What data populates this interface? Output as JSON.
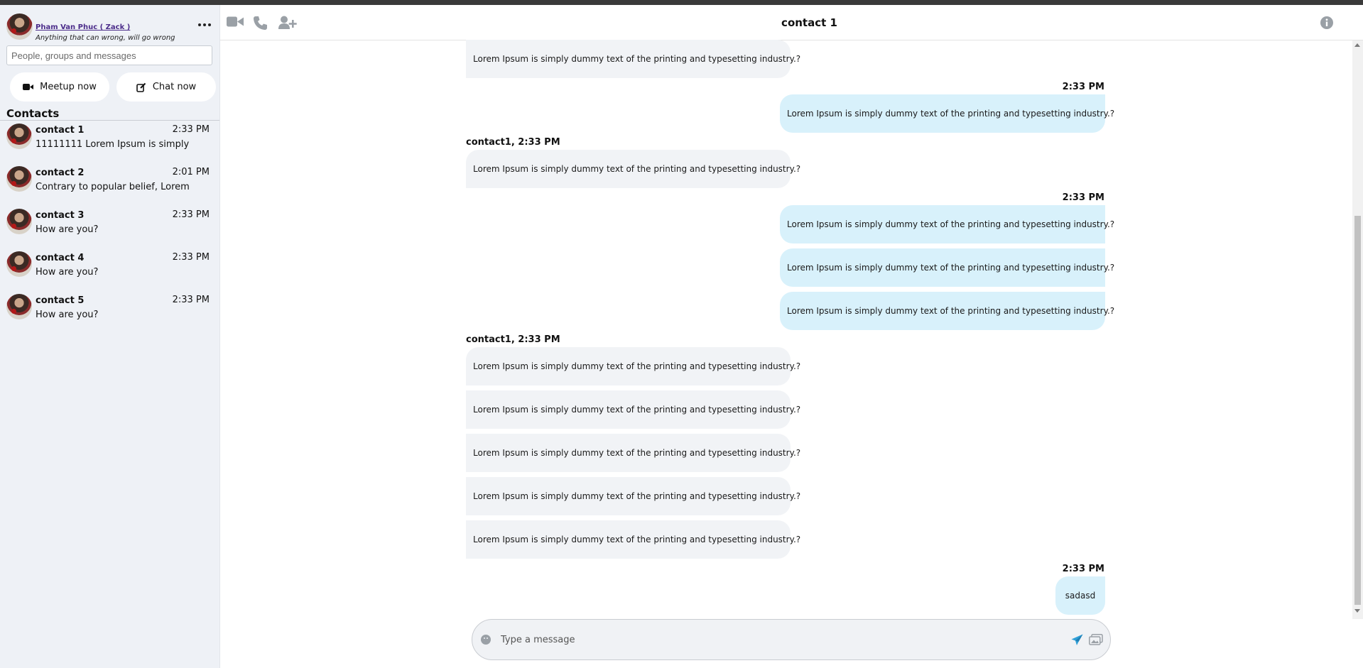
{
  "profile": {
    "name": "Pham Van Phuc ( Zack )",
    "status": "Anything that can wrong, will go wrong"
  },
  "search": {
    "placeholder": "People, groups and messages"
  },
  "actions": {
    "meetup_label": "Meetup now",
    "chat_label": "Chat now"
  },
  "contacts_title": "Contacts",
  "contacts": [
    {
      "name": "contact 1",
      "time": "2:33 PM",
      "preview": "11111111 Lorem Ipsum is simply"
    },
    {
      "name": "contact 2",
      "time": "2:01 PM",
      "preview": "Contrary to popular belief, Lorem"
    },
    {
      "name": "contact 3",
      "time": "2:33 PM",
      "preview": "How are you?"
    },
    {
      "name": "contact 4",
      "time": "2:33 PM",
      "preview": "How are you?"
    },
    {
      "name": "contact 5",
      "time": "2:33 PM",
      "preview": "How are you?"
    }
  ],
  "header": {
    "title": "contact 1"
  },
  "messages": {
    "m0": "Lorem Ipsum is simply dummy text of the printing and typesetting industry.?",
    "t1": "2:33 PM",
    "m1": "Lorem Ipsum is simply dummy text of the printing and typesetting industry.?",
    "t2": "contact1, 2:33 PM",
    "m2": "Lorem Ipsum is simply dummy text of the printing and typesetting industry.?",
    "t3": "2:33 PM",
    "m3": "Lorem Ipsum is simply dummy text of the printing and typesetting industry.?",
    "m4": "Lorem Ipsum is simply dummy text of the printing and typesetting industry.?",
    "m5": "Lorem Ipsum is simply dummy text of the printing and typesetting industry.?",
    "t4": "contact1, 2:33 PM",
    "m6": "Lorem Ipsum is simply dummy text of the printing and typesetting industry.?",
    "m7": "Lorem Ipsum is simply dummy text of the printing and typesetting industry.?",
    "m8": "Lorem Ipsum is simply dummy text of the printing and typesetting industry.?",
    "m9": "Lorem Ipsum is simply dummy text of the printing and typesetting industry.?",
    "m10": "Lorem Ipsum is simply dummy text of the printing and typesetting industry.?",
    "t5": "2:33 PM",
    "m11": "sadasd"
  },
  "composer": {
    "placeholder": "Type a message"
  },
  "icons": {
    "header": [
      "video-icon",
      "phone-icon",
      "add-user-icon",
      "info-icon"
    ],
    "composer": [
      "emoji-icon",
      "send-icon",
      "media-icon"
    ],
    "sidebar": [
      "more-icon",
      "video-icon",
      "edit-icon"
    ]
  },
  "colors": {
    "outgoing_bubble": "#d8f1fb",
    "incoming_bubble": "#f1f3f6",
    "sidebar_bg": "#eef1f6",
    "send_icon": "#2f9fd7",
    "profile_link": "#4b2c8a"
  }
}
